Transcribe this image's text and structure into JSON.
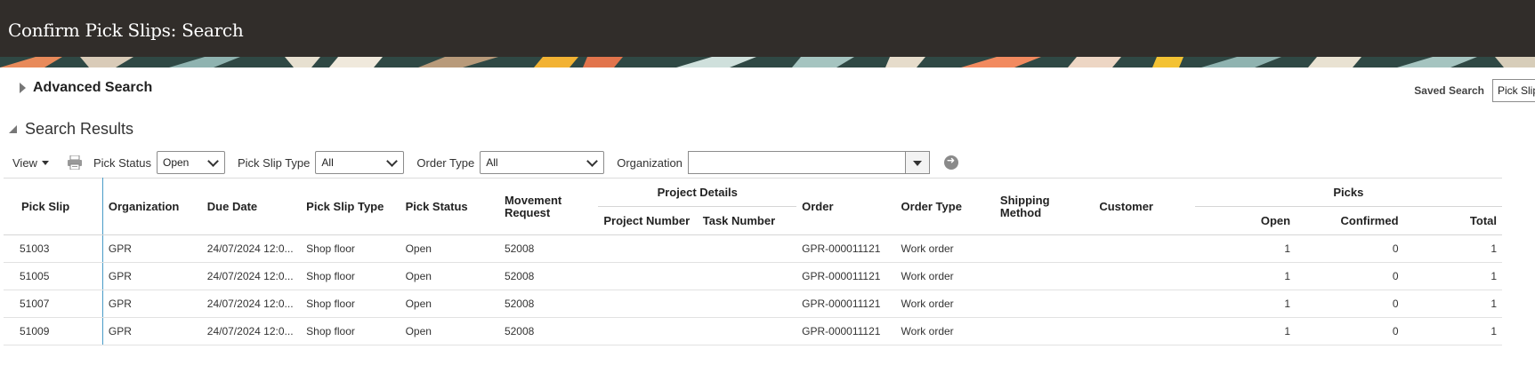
{
  "page": {
    "title": "Confirm Pick Slips: Search"
  },
  "advanced_search": {
    "label": "Advanced Search"
  },
  "saved_search": {
    "label": "Saved Search",
    "value": "Pick Slip"
  },
  "results": {
    "label": "Search Results"
  },
  "toolbar": {
    "view_label": "View",
    "pick_status": {
      "label": "Pick Status",
      "value": "Open"
    },
    "pick_slip_type": {
      "label": "Pick Slip Type",
      "value": "All"
    },
    "order_type": {
      "label": "Order Type",
      "value": "All"
    },
    "organization": {
      "label": "Organization",
      "value": ""
    }
  },
  "table": {
    "headers": {
      "pick_slip": "Pick Slip",
      "organization": "Organization",
      "due_date": "Due Date",
      "pick_slip_type": "Pick Slip Type",
      "pick_status": "Pick Status",
      "movement_request": "Movement Request",
      "project_details": "Project Details",
      "project_number": "Project Number",
      "task_number": "Task Number",
      "order": "Order",
      "order_type": "Order Type",
      "shipping_method": "Shipping Method",
      "customer": "Customer",
      "picks": "Picks",
      "open": "Open",
      "confirmed": "Confirmed",
      "total": "Total"
    },
    "rows": [
      {
        "pick_slip": "51003",
        "organization": "GPR",
        "due_date": "24/07/2024 12:0...",
        "pick_slip_type": "Shop floor",
        "pick_status": "Open",
        "movement_request": "52008",
        "project_number": "",
        "task_number": "",
        "order": "GPR-000011121",
        "order_type": "Work order",
        "shipping_method": "",
        "customer": "",
        "open": "1",
        "confirmed": "0",
        "total": "1"
      },
      {
        "pick_slip": "51005",
        "organization": "GPR",
        "due_date": "24/07/2024 12:0...",
        "pick_slip_type": "Shop floor",
        "pick_status": "Open",
        "movement_request": "52008",
        "project_number": "",
        "task_number": "",
        "order": "GPR-000011121",
        "order_type": "Work order",
        "shipping_method": "",
        "customer": "",
        "open": "1",
        "confirmed": "0",
        "total": "1"
      },
      {
        "pick_slip": "51007",
        "organization": "GPR",
        "due_date": "24/07/2024 12:0...",
        "pick_slip_type": "Shop floor",
        "pick_status": "Open",
        "movement_request": "52008",
        "project_number": "",
        "task_number": "",
        "order": "GPR-000011121",
        "order_type": "Work order",
        "shipping_method": "",
        "customer": "",
        "open": "1",
        "confirmed": "0",
        "total": "1"
      },
      {
        "pick_slip": "51009",
        "organization": "GPR",
        "due_date": "24/07/2024 12:0...",
        "pick_slip_type": "Shop floor",
        "pick_status": "Open",
        "movement_request": "52008",
        "project_number": "",
        "task_number": "",
        "order": "GPR-000011121",
        "order_type": "Work order",
        "shipping_method": "",
        "customer": "",
        "open": "1",
        "confirmed": "0",
        "total": "1"
      }
    ]
  },
  "icons": {
    "expand": "triangle-right-icon",
    "collapse": "triangle-down-icon",
    "print": "print-icon",
    "go": "arrow-right-circle-icon",
    "dropdown": "chevron-down-icon"
  },
  "colors": {
    "header_bg": "#312d2a",
    "link": "#1e5a8e",
    "frozen_divider": "#4a9cc8"
  }
}
